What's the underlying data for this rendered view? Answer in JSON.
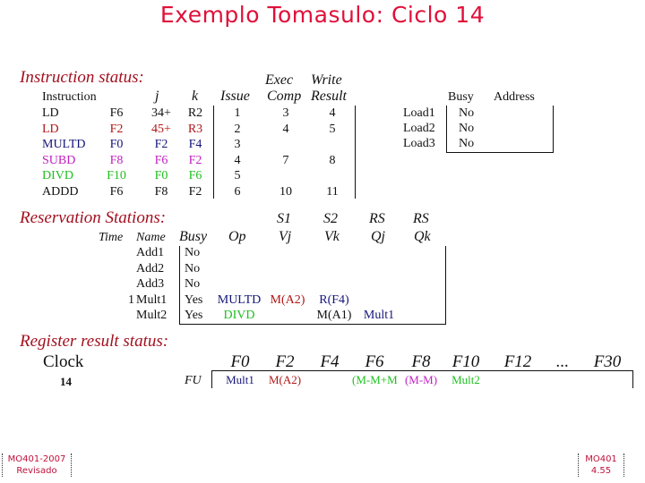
{
  "title": "Exemplo Tomasulo: Ciclo 14",
  "instruction_status": {
    "section_label": "Instruction status:",
    "headers": {
      "instruction": "Instruction",
      "j": "j",
      "k": "k",
      "issue": "Issue",
      "exec_top": "Exec",
      "exec_bottom": "Comp",
      "write_top": "Write",
      "write_bottom": "Result"
    },
    "rows": [
      {
        "op": "LD",
        "dest": "F6",
        "j": "34+",
        "k": "R2",
        "issue": "1",
        "exec": "3",
        "write": "4",
        "color": "black"
      },
      {
        "op": "LD",
        "dest": "F2",
        "j": "45+",
        "k": "R3",
        "issue": "2",
        "exec": "4",
        "write": "5",
        "color": "red"
      },
      {
        "op": "MULTD",
        "dest": "F0",
        "j": "F2",
        "k": "F4",
        "issue": "3",
        "exec": "",
        "write": "",
        "color": "blue"
      },
      {
        "op": "SUBD",
        "dest": "F8",
        "j": "F6",
        "k": "F2",
        "issue": "4",
        "exec": "7",
        "write": "8",
        "color": "magenta"
      },
      {
        "op": "DIVD",
        "dest": "F10",
        "j": "F0",
        "k": "F6",
        "issue": "5",
        "exec": "",
        "write": "",
        "color": "green"
      },
      {
        "op": "ADDD",
        "dest": "F6",
        "j": "F8",
        "k": "F2",
        "issue": "6",
        "exec": "10",
        "write": "11",
        "color": "black"
      }
    ]
  },
  "load_buffers": {
    "headers": {
      "busy": "Busy",
      "address": "Address"
    },
    "rows": [
      {
        "name": "Load1",
        "busy": "No",
        "address": ""
      },
      {
        "name": "Load2",
        "busy": "No",
        "address": ""
      },
      {
        "name": "Load3",
        "busy": "No",
        "address": ""
      }
    ]
  },
  "reservation_stations": {
    "section_label": "Reservation Stations:",
    "headers": {
      "time": "Time",
      "name": "Name",
      "busy": "Busy",
      "op": "Op",
      "s1": "S1",
      "vj": "Vj",
      "s2": "S2",
      "vk": "Vk",
      "rs_qj": "RS",
      "qj": "Qj",
      "rs_qk": "RS",
      "qk": "Qk"
    },
    "rows": [
      {
        "time": "",
        "name": "Add1",
        "busy": "No",
        "op": "",
        "vj": "",
        "vk": "",
        "qj": "",
        "qk": ""
      },
      {
        "time": "",
        "name": "Add2",
        "busy": "No",
        "op": "",
        "vj": "",
        "vk": "",
        "qj": "",
        "qk": ""
      },
      {
        "time": "",
        "name": "Add3",
        "busy": "No",
        "op": "",
        "vj": "",
        "vk": "",
        "qj": "",
        "qk": ""
      },
      {
        "time": "1",
        "name": "Mult1",
        "busy": "Yes",
        "op": "MULTD",
        "vj": "M(A2)",
        "vk": "R(F4)",
        "qj": "",
        "qk": ""
      },
      {
        "time": "",
        "name": "Mult2",
        "busy": "Yes",
        "op": "DIVD",
        "vj": "",
        "vk": "M(A1)",
        "qj": "Mult1",
        "qk": ""
      }
    ]
  },
  "register_result_status": {
    "section_label": "Register result status:",
    "clock_label": "Clock",
    "clock_value": "14",
    "fu_label": "FU",
    "registers": [
      "F0",
      "F2",
      "F4",
      "F6",
      "F8",
      "F10",
      "F12",
      "...",
      "F30"
    ],
    "values": [
      "Mult1",
      "M(A2)",
      "",
      "(M-M+M",
      "(M-M)",
      "Mult2",
      "",
      "",
      ""
    ]
  },
  "colors": {
    "title": "#e0103a",
    "section": "#a3101f",
    "black": "#111111",
    "red": "#b01616",
    "blue": "#15157a",
    "magenta": "#c020c0",
    "green": "#1fbf1f"
  },
  "footer": {
    "left_line1": "MO401-2007",
    "left_line2": "Revisado",
    "right_line1": "MO401",
    "right_line2": "4.55"
  }
}
